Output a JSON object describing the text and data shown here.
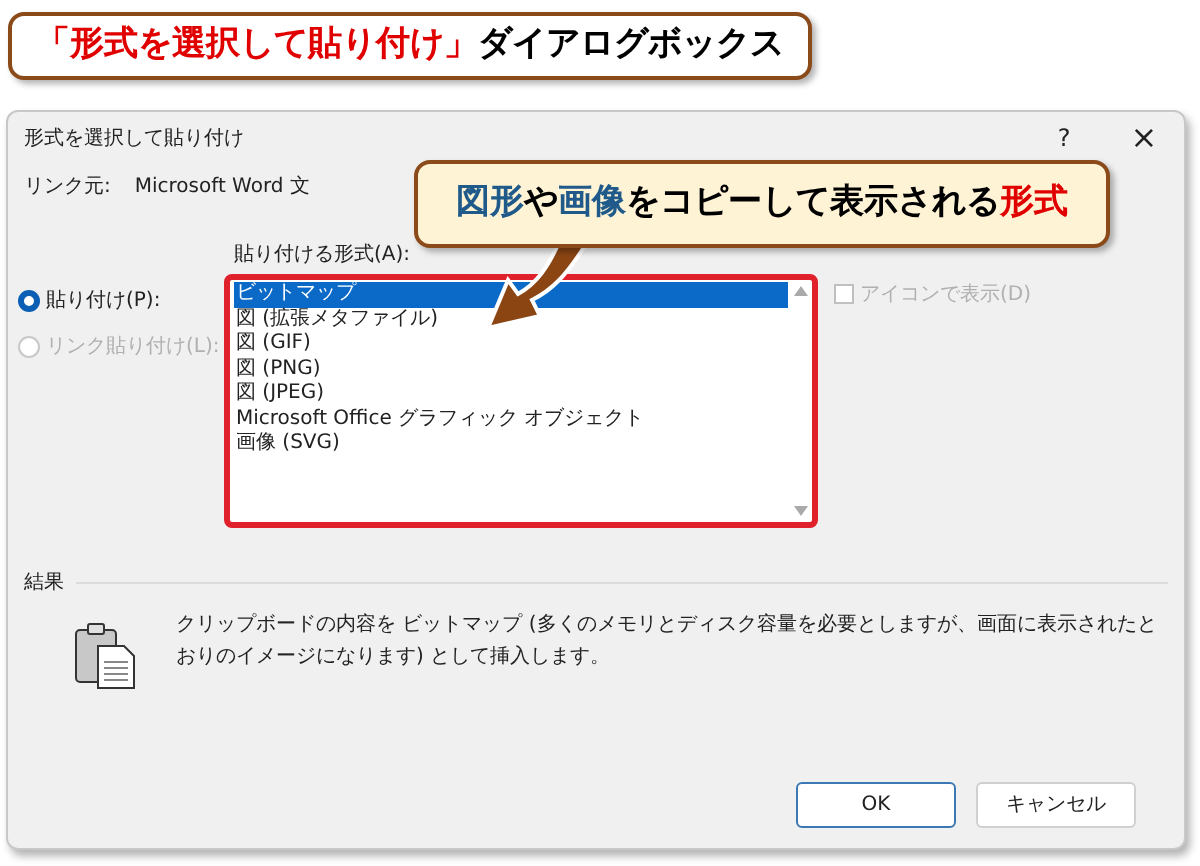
{
  "banner": {
    "highlight": "「形式を選択して貼り付け」",
    "rest": "ダイアログボックス"
  },
  "dialog": {
    "title": "形式を選択して貼り付け",
    "help": "?",
    "close": "×",
    "source_label": "リンク元:",
    "source_value": "Microsoft Word 文",
    "list_label": "貼り付ける形式(A):",
    "radios": [
      {
        "label": "貼り付け(P):",
        "selected": true,
        "disabled": false
      },
      {
        "label": "リンク貼り付け(L):",
        "selected": false,
        "disabled": true
      }
    ],
    "formats": [
      {
        "label": "ビットマップ",
        "selected": true
      },
      {
        "label": "図 (拡張メタファイル)",
        "selected": false
      },
      {
        "label": "図 (GIF)",
        "selected": false
      },
      {
        "label": "図 (PNG)",
        "selected": false
      },
      {
        "label": "図 (JPEG)",
        "selected": false
      },
      {
        "label": "Microsoft Office グラフィック オブジェクト",
        "selected": false
      },
      {
        "label": "画像 (SVG)",
        "selected": false
      }
    ],
    "icon_checkbox": {
      "label": "アイコンで表示(D)",
      "checked": false,
      "disabled": true
    },
    "result_label": "結果",
    "result_text": "クリップボードの内容を ビットマップ (多くのメモリとディスク容量を必要としますが、画面に表示されたとおりのイメージになります) として挿入します。",
    "buttons": [
      {
        "label": "OK",
        "default": true
      },
      {
        "label": "キャンセル",
        "default": false
      }
    ]
  },
  "callout": {
    "segments": [
      {
        "text": "図形",
        "kind": "term"
      },
      {
        "text": "や",
        "kind": "plain"
      },
      {
        "text": "画像",
        "kind": "term"
      },
      {
        "text": "をコピーして表示される",
        "kind": "plain"
      },
      {
        "text": "形式",
        "kind": "emphasis"
      }
    ]
  }
}
